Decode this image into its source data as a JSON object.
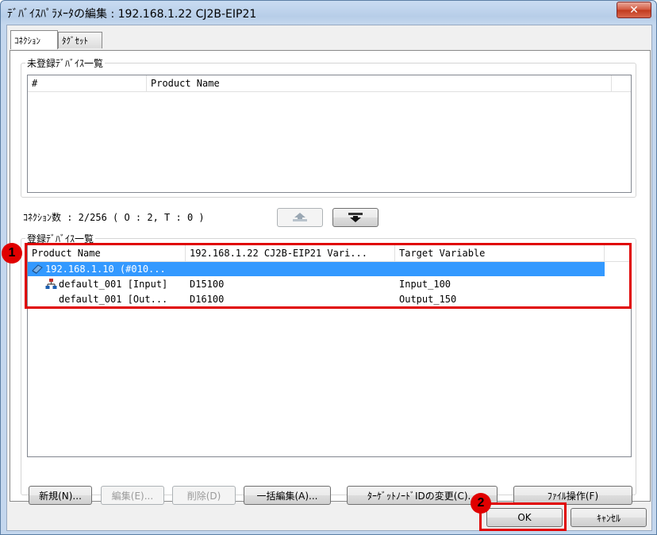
{
  "window": {
    "title": "ﾃﾞﾊﾞｲｽﾊﾟﾗﾒｰﾀの編集 : 192.168.1.22 CJ2B-EIP21",
    "close_glyph": "✕"
  },
  "tabs": [
    {
      "label": "ｺﾈｸｼｮﾝ",
      "active": true
    },
    {
      "label": "ﾀｸﾞｾｯﾄ",
      "active": false
    }
  ],
  "unregistered": {
    "label": "未登録ﾃﾞﾊﾞｲｽ一覧",
    "columns": [
      "#",
      "Product Name"
    ]
  },
  "connection_count": "ｺﾈｸｼｮﾝ数 : 2/256 ( O : 2, T : 0 )",
  "registered": {
    "label": "登録ﾃﾞﾊﾞｲｽ一覧",
    "columns": [
      "Product Name",
      "192.168.1.22 CJ2B-EIP21 Vari...",
      "Target Variable"
    ],
    "device_row": {
      "name": "192.168.1.10 (#010..."
    },
    "rows": [
      {
        "name": "default_001 [Input]",
        "variable": "D15100",
        "target": "Input_100",
        "icon": "io-node-icon"
      },
      {
        "name": "default_001 [Out...",
        "variable": "D16100",
        "target": "Output_150",
        "icon": ""
      }
    ]
  },
  "buttons": {
    "new": "新規(N)...",
    "edit": "編集(E)...",
    "delete": "削除(D)",
    "bulk_edit": "一括編集(A)...",
    "change_node_id": "ﾀｰｹﾞｯﾄﾉｰﾄﾞIDの変更(C)...",
    "file_ops": "ﾌｧｲﾙ操作(F)",
    "ok": "OK",
    "cancel": "ｷｬﾝｾﾙ"
  },
  "markers": {
    "one": "1",
    "two": "2"
  },
  "colors": {
    "selection": "#3399ff",
    "highlight": "#e00000"
  }
}
